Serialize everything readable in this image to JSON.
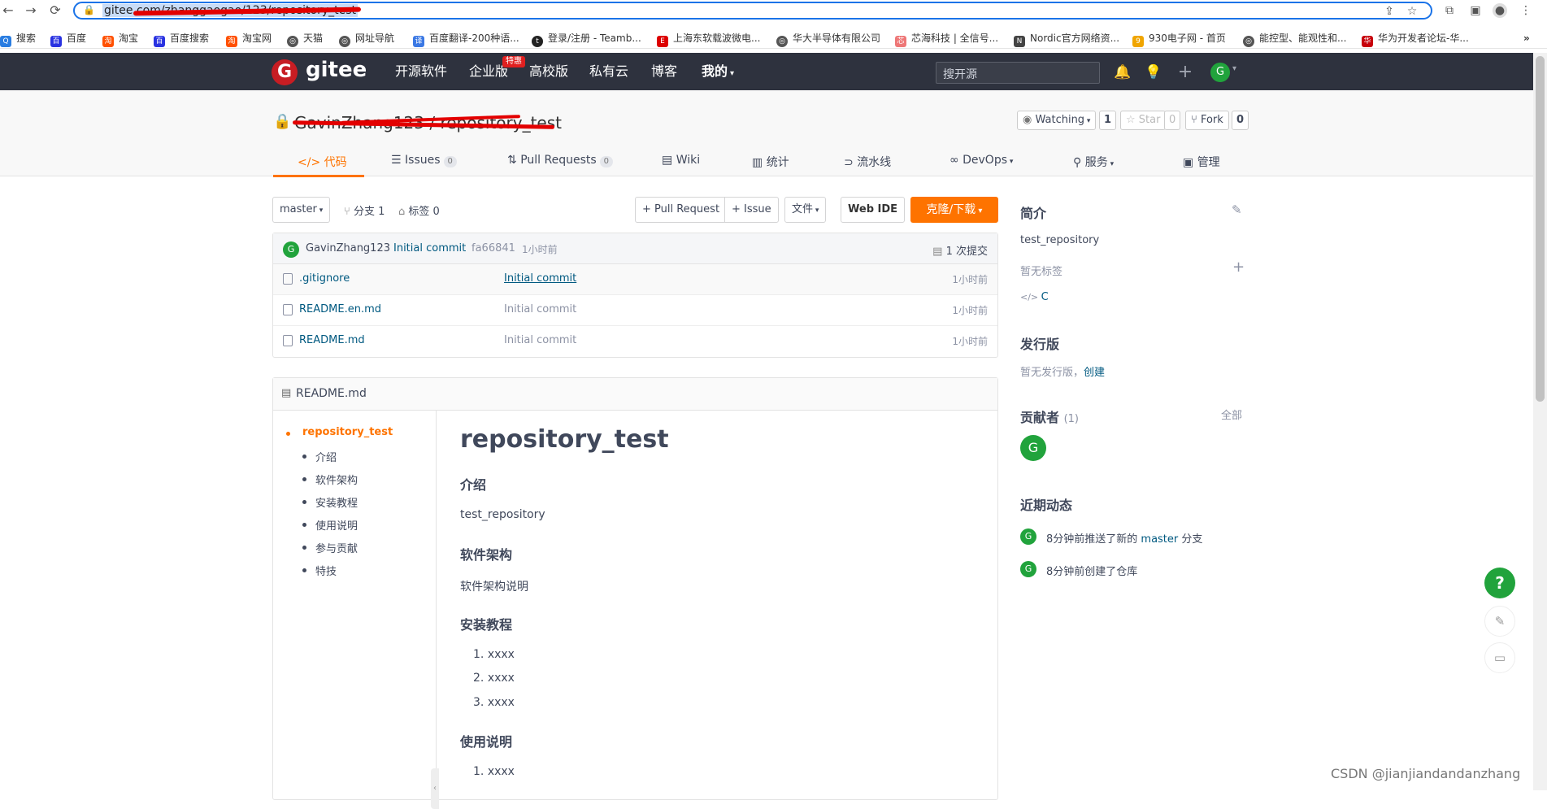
{
  "browser": {
    "url": "gitee.com/zhanggaogao/123/repository_test",
    "bookmarks": [
      "搜索",
      "百度",
      "淘宝",
      "百度搜索",
      "淘宝网",
      "天猫",
      "网址导航",
      "百度翻译-200种语...",
      "登录/注册 - Teamb...",
      "上海东软载波微电...",
      "华大半导体有限公司",
      "芯海科技 | 全信号...",
      "Nordic官方网络资...",
      "930电子网 - 首页",
      "能控型、能观性和...",
      "华为开发者论坛-华..."
    ],
    "more": "»"
  },
  "header": {
    "logo_letter": "G",
    "logo_text": "gitee",
    "nav": [
      "开源软件",
      "企业版",
      "高校版",
      "私有云",
      "博客",
      "我的"
    ],
    "badge": "特惠",
    "search_placeholder": "搜开源",
    "avatar_letter": "G"
  },
  "repo": {
    "title": "GavinZhang123 / repository_test",
    "watch_label": "Watching",
    "watch_count": "1",
    "star_label": "Star",
    "star_count": "0",
    "fork_label": "Fork",
    "fork_count": "0",
    "tabs": [
      {
        "label": "代码",
        "icon": "code-icon"
      },
      {
        "label": "Issues",
        "count": "0",
        "icon": "issues-icon"
      },
      {
        "label": "Pull Requests",
        "count": "0",
        "icon": "pr-icon"
      },
      {
        "label": "Wiki",
        "icon": "wiki-icon"
      },
      {
        "label": "统计",
        "icon": "stats-icon"
      },
      {
        "label": "流水线",
        "icon": "pipeline-icon"
      },
      {
        "label": "DevOps",
        "icon": "devops-icon"
      },
      {
        "label": "服务",
        "icon": "service-icon"
      },
      {
        "label": "管理",
        "icon": "manage-icon"
      }
    ]
  },
  "toolbar": {
    "branch": "master",
    "branches": "分支 1",
    "tags": "标签 0",
    "pull_request": "+ Pull Request",
    "issue": "+ Issue",
    "file": "文件",
    "web_ide": "Web IDE",
    "clone": "克隆/下载"
  },
  "commit": {
    "avatar": "G",
    "author": "GavinZhang123",
    "message": "Initial commit",
    "hash": "fa66841",
    "time": "1小时前",
    "total": "1 次提交"
  },
  "files": [
    {
      "name": ".gitignore",
      "commit": "Initial commit",
      "time": "1小时前"
    },
    {
      "name": "README.en.md",
      "commit": "Initial commit",
      "time": "1小时前"
    },
    {
      "name": "README.md",
      "commit": "Initial commit",
      "time": "1小时前"
    }
  ],
  "readme": {
    "filename": "README.md",
    "toc_root": "repository_test",
    "toc": [
      "介绍",
      "软件架构",
      "安装教程",
      "使用说明",
      "参与贡献",
      "特技"
    ],
    "h1": "repository_test",
    "sec1_title": "介绍",
    "sec1_text": "test_repository",
    "sec2_title": "软件架构",
    "sec2_text": "软件架构说明",
    "sec3_title": "安装教程",
    "sec3_items": [
      "xxxx",
      "xxxx",
      "xxxx"
    ],
    "sec4_title": "使用说明",
    "sec4_items": [
      "xxxx"
    ]
  },
  "sidebar": {
    "intro_title": "简介",
    "intro_text": "test_repository",
    "no_tags": "暂无标签",
    "language": "C",
    "release_title": "发行版",
    "no_release": "暂无发行版，",
    "create_link": "创建",
    "contributors_title": "贡献者",
    "contributors_count": "(1)",
    "all_link": "全部",
    "contributor_avatar": "G",
    "activity_title": "近期动态",
    "activity": [
      {
        "pre": "8分钟前推送了新的 ",
        "link": "master",
        "post": " 分支"
      },
      {
        "pre": "8分钟前创建了仓库",
        "link": "",
        "post": ""
      }
    ]
  },
  "float": {
    "help": "?"
  },
  "watermark": "CSDN @jianjiandandanzhang",
  "colors": {
    "accent": "#fe7300",
    "brand": "#c71d23",
    "header_bg": "#2e323e",
    "link": "#005980",
    "avatar": "#21a33c"
  }
}
